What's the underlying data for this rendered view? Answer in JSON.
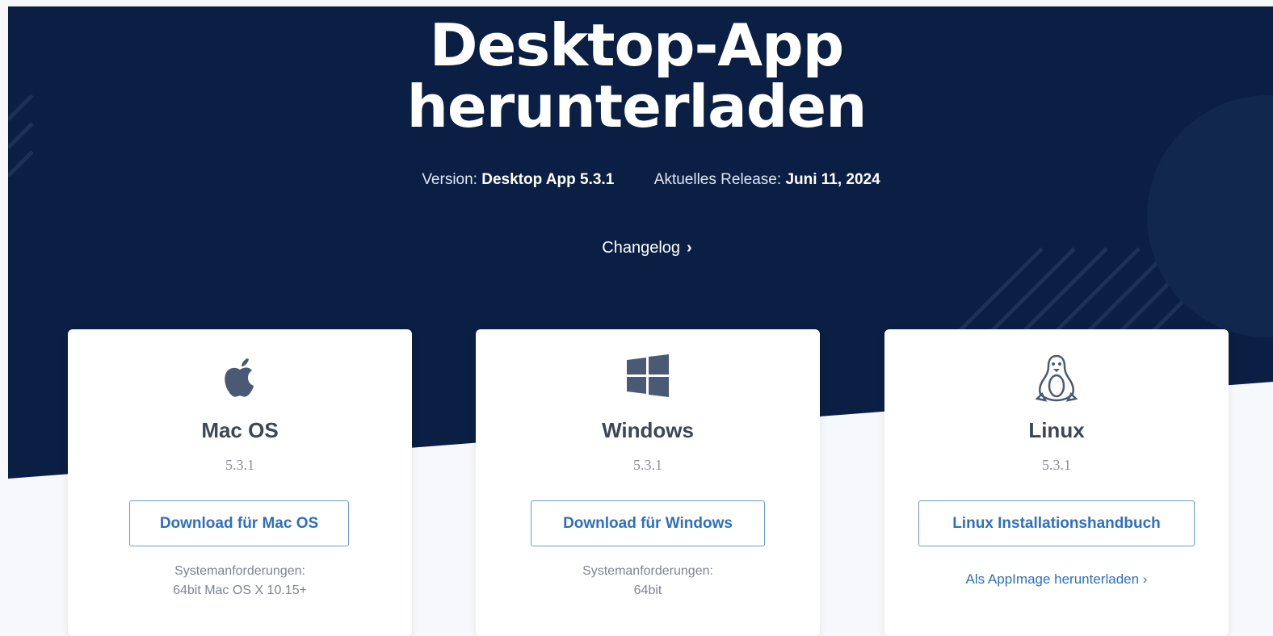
{
  "hero": {
    "title_line1": "Desktop-App",
    "title_line2": "herunterladen",
    "version_label": "Version:",
    "version_value": "Desktop App 5.3.1",
    "release_label": "Aktuelles Release:",
    "release_value": "Juni 11, 2024",
    "changelog_label": "Changelog",
    "changelog_chevron": "›"
  },
  "cards": [
    {
      "icon": "apple-icon",
      "name": "Mac OS",
      "version": "5.3.1",
      "button_label": "Download für Mac OS",
      "requirements_line1": "Systemanforderungen:",
      "requirements_line2": "64bit Mac OS X 10.15+"
    },
    {
      "icon": "windows-icon",
      "name": "Windows",
      "version": "5.3.1",
      "button_label": "Download für Windows",
      "requirements_line1": "Systemanforderungen:",
      "requirements_line2": "64bit"
    },
    {
      "icon": "linux-tux-icon",
      "name": "Linux",
      "version": "5.3.1",
      "button_label": "Linux Installationshandbuch",
      "appimage_link": "Als AppImage herunterladen ›"
    }
  ],
  "colors": {
    "hero_background": "#0b1f44",
    "link_blue": "#2f6fbf",
    "icon_slate": "#4a5a74"
  }
}
